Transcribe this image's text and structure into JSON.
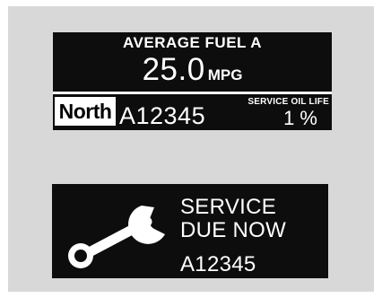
{
  "fuel_display": {
    "title": "AVERAGE FUEL A",
    "value": "25.0",
    "unit": "MPG",
    "compass": "North",
    "odometer": "A12345",
    "oil_life_label": "SERVICE OIL LIFE",
    "oil_life_value": "1 %"
  },
  "service_display": {
    "line1": "SERVICE",
    "line2": "DUE NOW",
    "odometer": "A12345",
    "icon": "wrench-icon"
  },
  "colors": {
    "display_bg": "#0d0d0d",
    "display_text": "#ffffff",
    "panel_bg": "#d8d8d8"
  }
}
